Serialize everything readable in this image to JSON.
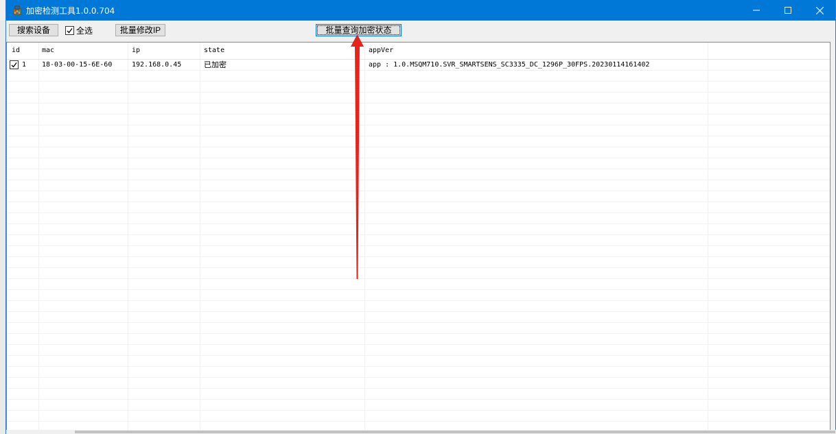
{
  "window": {
    "title": "加密检测工具1.0.0.704",
    "minimize_icon": "minimize-icon",
    "maximize_icon": "maximize-icon",
    "close_icon": "close-icon",
    "accent_color": "#0078d7"
  },
  "toolbar": {
    "search_label": "搜索设备",
    "select_all_label": "全选",
    "select_all_checked": true,
    "batch_ip_label": "批量修改IP",
    "batch_query_label": "批量查询加密状态"
  },
  "table": {
    "columns": [
      "id",
      "mac",
      "ip",
      "state",
      "appVer"
    ],
    "rows": [
      {
        "checked": true,
        "id": "1",
        "mac": "18-03-00-15-6E-60",
        "ip": "192.168.0.45",
        "state": "已加密",
        "appVer": "app : 1.0.MSQM710.SVR_SMARTSENS_SC3335_DC_1296P_30FPS.20230114161402"
      }
    ]
  },
  "annotation": {
    "arrow_color": "#e8231c"
  }
}
